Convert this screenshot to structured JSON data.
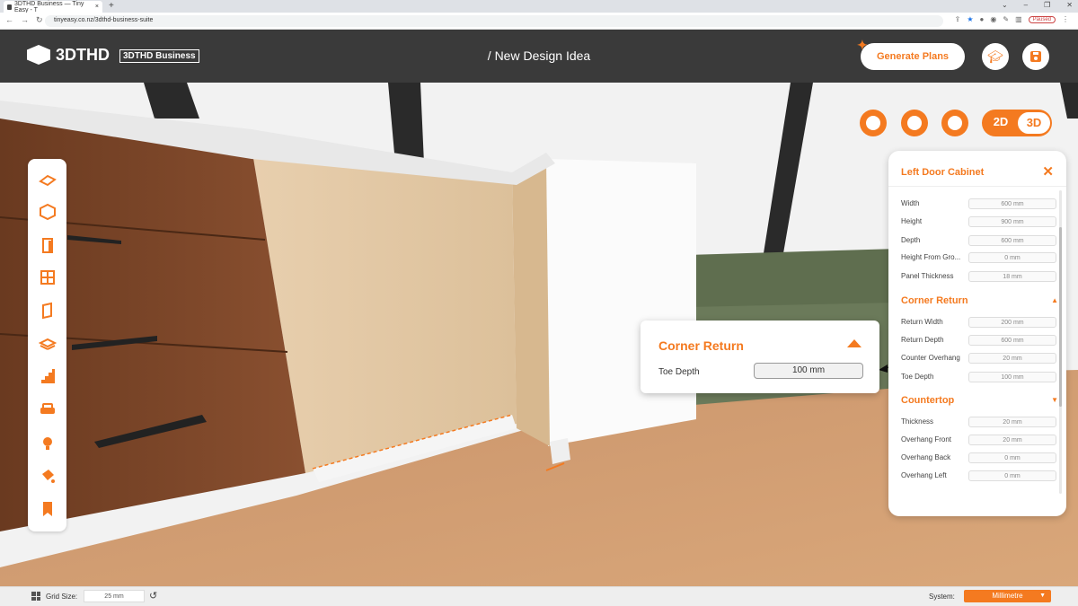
{
  "browser": {
    "tab_title": "3DTHD Business — Tiny Easy - T",
    "tab_close": "×",
    "new_tab": "+",
    "url": "tinyeasy.co.nz/3dthd-business-suite",
    "paused": "Paused"
  },
  "header": {
    "logo_text": "3DTHD",
    "business_badge": "3DTHD Business",
    "doc_title": "/ New Design Idea",
    "generate_label": "Generate Plans"
  },
  "view_toggle": {
    "mode_2d": "2D",
    "mode_3d": "3D"
  },
  "panel": {
    "title": "Left Door Cabinet",
    "rows_top": [
      {
        "label": "Width",
        "value": "600 mm"
      },
      {
        "label": "Height",
        "value": "900 mm"
      },
      {
        "label": "Depth",
        "value": "600 mm"
      },
      {
        "label": "Height From Gro...",
        "value": "0 mm"
      },
      {
        "label": "Panel Thickness",
        "value": "18 mm"
      }
    ],
    "section_corner": "Corner Return",
    "rows_corner": [
      {
        "label": "Return Width",
        "value": "200 mm"
      },
      {
        "label": "Return Depth",
        "value": "600 mm"
      },
      {
        "label": "Counter Overhang",
        "value": "20 mm"
      },
      {
        "label": "Toe Depth",
        "value": "100 mm"
      }
    ],
    "section_countertop": "Countertop",
    "rows_countertop": [
      {
        "label": "Thickness",
        "value": "20 mm"
      },
      {
        "label": "Overhang Front",
        "value": "20 mm"
      },
      {
        "label": "Overhang Back",
        "value": "0 mm"
      },
      {
        "label": "Overhang Left",
        "value": "0 mm"
      }
    ]
  },
  "popup": {
    "title": "Corner Return",
    "label": "Toe Depth",
    "value": "100 mm"
  },
  "footer": {
    "grid_label": "Grid Size:",
    "grid_value": "25 mm",
    "system_label": "System:",
    "system_value": "Millimetre"
  },
  "colors": {
    "accent": "#f47a20",
    "header_bg": "#3a3a3a"
  }
}
